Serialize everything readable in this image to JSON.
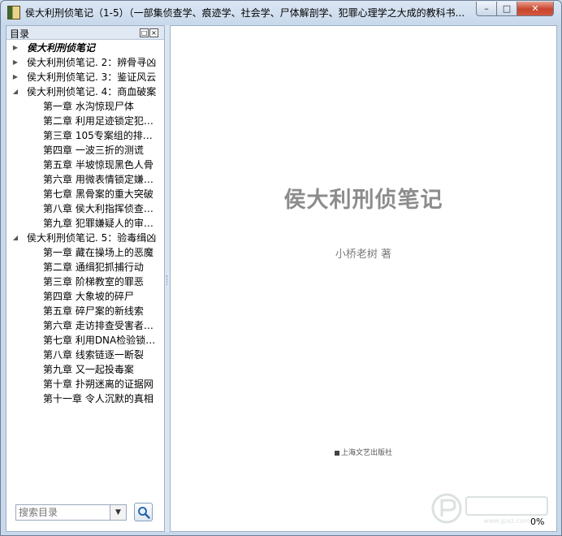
{
  "window": {
    "title": "侯大利刑侦笔记（1-5）（一部集侦查学、痕迹学、社会学、尸体解剖学、犯罪心理学之大成的教科书..."
  },
  "sidebar": {
    "title": "目录",
    "items": [
      {
        "label": "侯大利刑侦笔记",
        "level": 0,
        "state": "collapsed",
        "selected": true
      },
      {
        "label": "侯大利刑侦笔记. 2：辨骨寻凶",
        "level": 0,
        "state": "collapsed"
      },
      {
        "label": "侯大利刑侦笔记. 3：鉴证风云",
        "level": 0,
        "state": "collapsed"
      },
      {
        "label": "侯大利刑侦笔记. 4：商血破案",
        "level": 0,
        "state": "expanded"
      },
      {
        "label": "第一章  水沟惊现尸体",
        "level": 1
      },
      {
        "label": "第二章  利用足迹锁定犯…",
        "level": 1
      },
      {
        "label": "第三章  105专案组的排…",
        "level": 1
      },
      {
        "label": "第四章  一波三折的测谎",
        "level": 1
      },
      {
        "label": "第五章  半坡惊现黑色人骨",
        "level": 1
      },
      {
        "label": "第六章  用微表情锁定嫌…",
        "level": 1
      },
      {
        "label": "第七章  黑骨案的重大突破",
        "level": 1
      },
      {
        "label": "第八章  侯大利指挥侦查…",
        "level": 1
      },
      {
        "label": "第九章  犯罪嫌疑人的审…",
        "level": 1
      },
      {
        "label": "侯大利刑侦笔记. 5：验毒缉凶",
        "level": 0,
        "state": "expanded"
      },
      {
        "label": "第一章  藏在操场上的恶魔",
        "level": 1
      },
      {
        "label": "第二章  通缉犯抓捕行动",
        "level": 1
      },
      {
        "label": "第三章  阶梯教室的罪恶",
        "level": 1
      },
      {
        "label": "第四章  大象坡的碎尸",
        "level": 1
      },
      {
        "label": "第五章  碎尸案的新线索",
        "level": 1
      },
      {
        "label": "第六章  走访排查受害者…",
        "level": 1
      },
      {
        "label": "第七章  利用DNA检验锁…",
        "level": 1
      },
      {
        "label": "第八章  线索链逐一断裂",
        "level": 1
      },
      {
        "label": "第九章  又一起投毒案",
        "level": 1
      },
      {
        "label": "第十章  扑朔迷离的证据网",
        "level": 1
      },
      {
        "label": "第十一章  令人沉默的真相",
        "level": 1
      }
    ],
    "search": {
      "placeholder": "搜索目录"
    }
  },
  "page": {
    "title": "侯大利刑侦笔记",
    "author": "小桥老树  著",
    "publisher": "上海文艺出版社",
    "watermark": "www.jpxz.com",
    "progress": "0%"
  },
  "icons": {
    "app": "book-app-icon",
    "minimize": "minimize-icon",
    "maximize": "maximize-icon",
    "close": "close-icon",
    "search": "magnifier-icon",
    "dropdown": "triangle-down-icon"
  },
  "colors": {
    "close_button": "#c7452c",
    "title_text_gray": "#8c8c8c"
  }
}
